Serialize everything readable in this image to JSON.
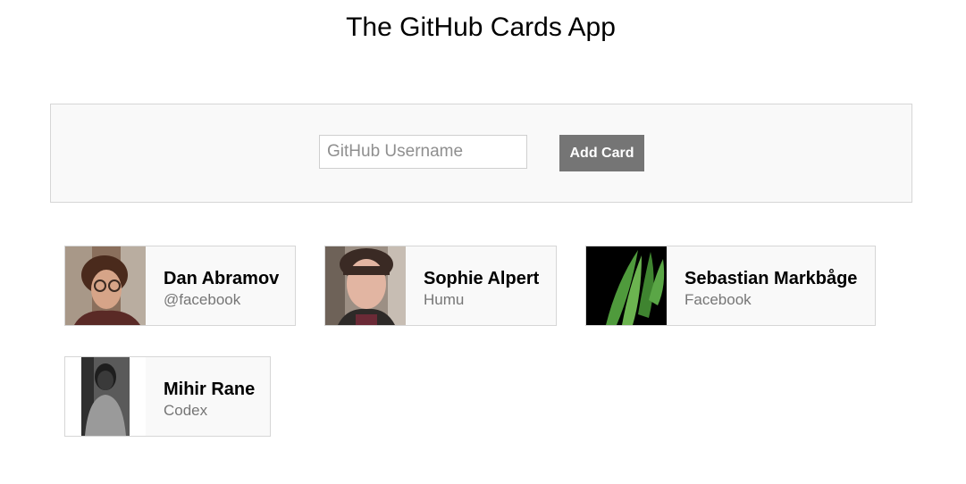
{
  "app": {
    "title": "The GitHub Cards App"
  },
  "form": {
    "input_value": "",
    "input_placeholder": "GitHub Username",
    "submit_label": "Add Card"
  },
  "cards": [
    {
      "name": "Dan Abramov",
      "company": "@facebook",
      "avatar_icon": "person-photo-icon"
    },
    {
      "name": "Sophie Alpert",
      "company": "Humu",
      "avatar_icon": "person-photo-icon"
    },
    {
      "name": "Sebastian Markbåge",
      "company": "Facebook",
      "avatar_icon": "plant-leaves-icon"
    },
    {
      "name": "Mihir Rane",
      "company": "Codex",
      "avatar_icon": "person-photo-icon"
    }
  ],
  "colors": {
    "button_bg": "#757575",
    "panel_bg": "#f9f9f9",
    "border": "#d6d6d6",
    "company_text": "#767676"
  }
}
